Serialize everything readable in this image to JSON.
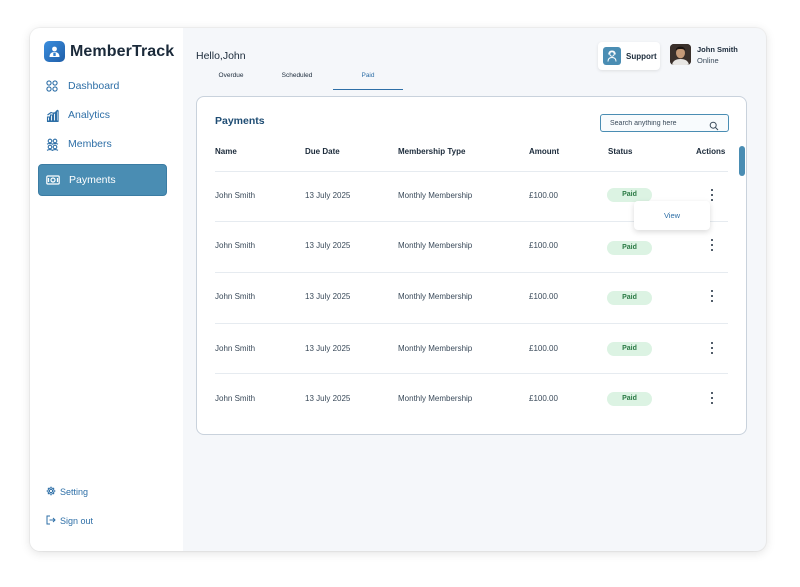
{
  "app": {
    "name": "MemberTrack"
  },
  "sidebar": {
    "items": [
      {
        "label": "Dashboard",
        "icon": "grid-icon",
        "active": false
      },
      {
        "label": "Analytics",
        "icon": "bar-chart-icon",
        "active": false
      },
      {
        "label": "Members",
        "icon": "members-icon",
        "active": false
      },
      {
        "label": "Payments",
        "icon": "cash-icon",
        "active": true
      }
    ],
    "bottom": [
      {
        "label": "Setting",
        "icon": "gear-icon"
      },
      {
        "label": "Sign out",
        "icon": "sign-out-icon"
      }
    ]
  },
  "header": {
    "greeting": "Hello,John",
    "support_label": "Support",
    "user": {
      "name": "John Smith",
      "status": "Online"
    }
  },
  "tabs": [
    {
      "label": "Overdue",
      "active": false
    },
    {
      "label": "Scheduled",
      "active": false
    },
    {
      "label": "Paid",
      "active": true
    }
  ],
  "payments": {
    "title": "Payments",
    "search_placeholder": "Search anything here",
    "columns": [
      "Name",
      "Due Date",
      "Membership Type",
      "Amount",
      "Status",
      "Actions"
    ],
    "rows": [
      {
        "name": "John Smith",
        "due_date": "13  July 2025",
        "type": "Monthly Membership",
        "amount": "£100.00",
        "status": "Paid"
      },
      {
        "name": "John Smith",
        "due_date": "13  July 2025",
        "type": "Monthly Membership",
        "amount": "£100.00",
        "status": "Paid"
      },
      {
        "name": "John Smith",
        "due_date": "13  July 2025",
        "type": "Monthly Membership",
        "amount": "£100.00",
        "status": "Paid"
      },
      {
        "name": "John Smith",
        "due_date": "13  July 2025",
        "type": "Monthly Membership",
        "amount": "£100.00",
        "status": "Paid"
      },
      {
        "name": "John Smith",
        "due_date": "13  July 2025",
        "type": "Monthly Membership",
        "amount": "£100.00",
        "status": "Paid"
      }
    ],
    "action_menu": {
      "view_label": "View"
    }
  },
  "colors": {
    "accent": "#4a8db3",
    "nav_text": "#2e6fa7",
    "paid_badge_bg": "#dcf3e3",
    "paid_badge_text": "#2b7a45"
  }
}
